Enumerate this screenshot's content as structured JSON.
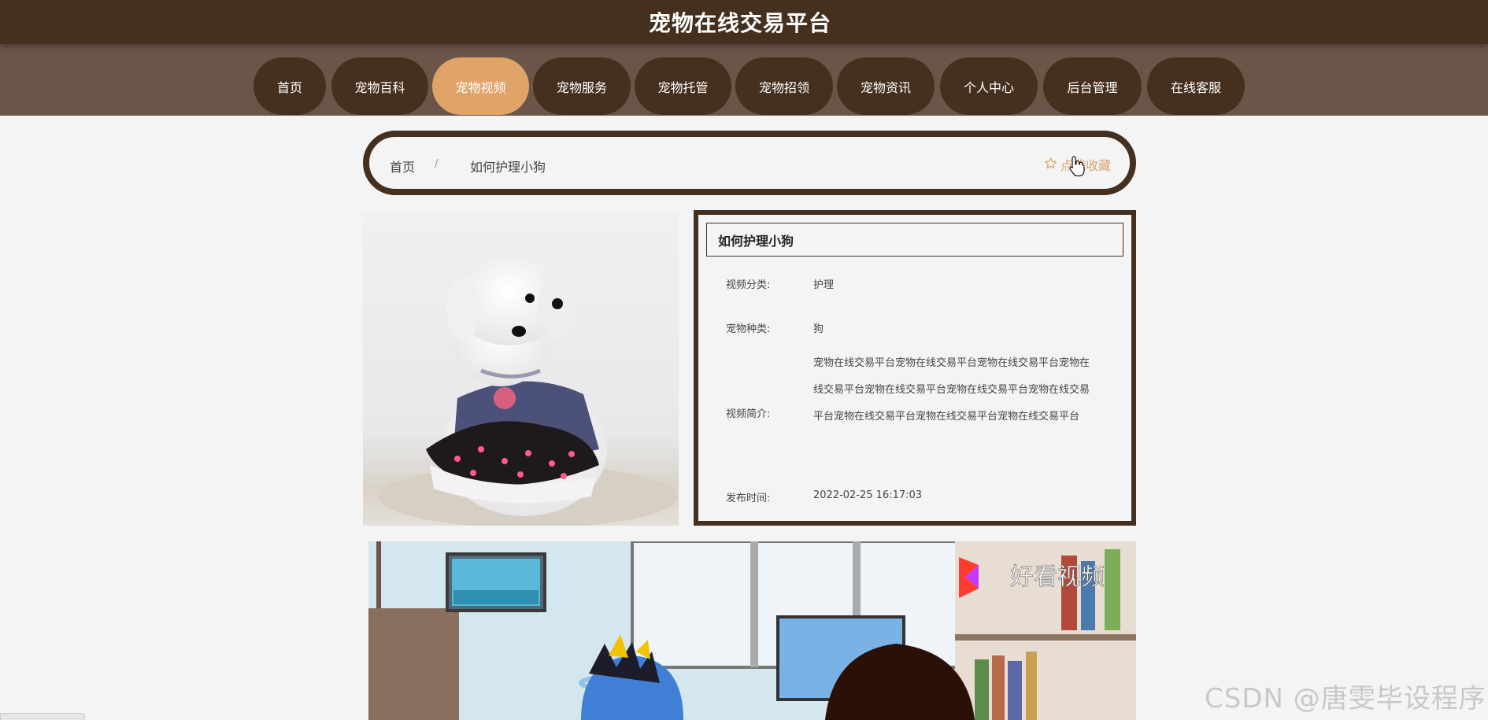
{
  "header": {
    "title": "宠物在线交易平台"
  },
  "nav": {
    "items": [
      {
        "label": "首页"
      },
      {
        "label": "宠物百科"
      },
      {
        "label": "宠物视频"
      },
      {
        "label": "宠物服务"
      },
      {
        "label": "宠物托管"
      },
      {
        "label": "宠物招领"
      },
      {
        "label": "宠物资讯"
      },
      {
        "label": "个人中心"
      },
      {
        "label": "后台管理"
      },
      {
        "label": "在线客服"
      }
    ],
    "active": "宠物视频"
  },
  "breadcrumb": {
    "home": "首页",
    "separator": "/",
    "current": "如何护理小狗",
    "favorite_label": "点我收藏"
  },
  "detail": {
    "title": "如何护理小狗",
    "fields": [
      {
        "label": "视频分类:",
        "value": "护理"
      },
      {
        "label": "宠物种类:",
        "value": "狗"
      },
      {
        "label": "视频简介:",
        "value": "宠物在线交易平台宠物在线交易平台宠物在线交易平台宠物在线交易平台宠物在线交易平台宠物在线交易平台宠物在线交易平台宠物在线交易平台宠物在线交易平台宠物在线交易平台"
      },
      {
        "label": "发布时间:",
        "value": "2022-02-25 16:17:03"
      }
    ]
  },
  "video": {
    "brand": "好看视频"
  },
  "watermark": "CSDN @唐雯毕设程序",
  "colors": {
    "dark_brown": "#45301f",
    "nav_bar": "#6b5549",
    "accent": "#e0a368",
    "favorite": "#d9a470",
    "background": "#f4f4f4"
  }
}
